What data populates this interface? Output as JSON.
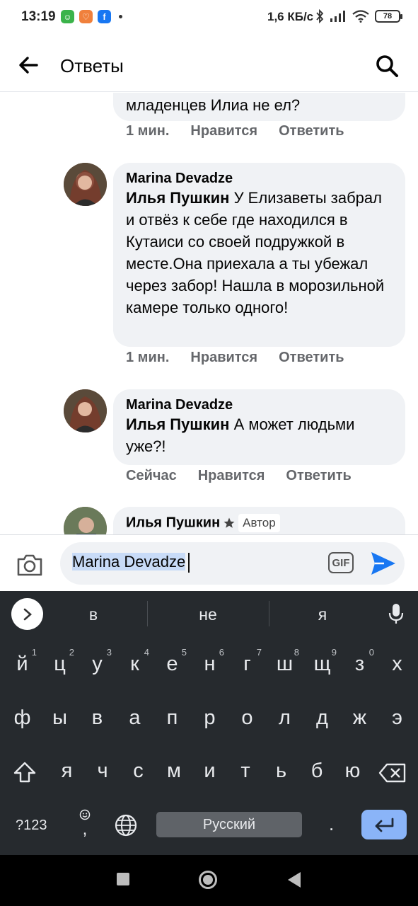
{
  "status_bar": {
    "time": "13:19",
    "net_speed": "1,6 КБ/с",
    "battery": "78",
    "app_icons": [
      {
        "name": "wechat-icon",
        "color": "#3bb34a",
        "glyph": "☺"
      },
      {
        "name": "notification-app-icon",
        "color": "#f0803c",
        "glyph": "♡"
      },
      {
        "name": "facebook-icon",
        "color": "#1877f2",
        "glyph": "f"
      }
    ]
  },
  "header": {
    "title": "Ответы"
  },
  "comments": [
    {
      "partial": true,
      "text": "младенцев Илиа не ел?",
      "time": "1 мин.",
      "like": "Нравится",
      "reply": "Ответить"
    },
    {
      "author": "Marina Devadze",
      "mention": "Илья Пушкин",
      "text": " У Елизаветы забрал и отвёз к себе где находился в Кутаиси со своей подружкой в месте.Она приехала а ты убежал через забор! Нашла в морозильной камере только одного!",
      "time": "1 мин.",
      "like": "Нравится",
      "reply": "Ответить"
    },
    {
      "author": "Marina Devadze",
      "mention": "Илья Пушкин",
      "text": " А может людьми уже?!",
      "time": "Сейчас",
      "like": "Нравится",
      "reply": "Ответить"
    },
    {
      "author": "Илья Пушкин",
      "badge": "Автор"
    }
  ],
  "composer": {
    "value": "Marina Devadze",
    "gif_label": "GIF"
  },
  "keyboard": {
    "suggestions": [
      "в",
      "не",
      "я"
    ],
    "row1": [
      "й",
      "ц",
      "у",
      "к",
      "е",
      "н",
      "г",
      "ш",
      "щ",
      "з",
      "х"
    ],
    "row1_hints": [
      "1",
      "2",
      "3",
      "4",
      "5",
      "6",
      "7",
      "8",
      "9",
      "0"
    ],
    "row2": [
      "ф",
      "ы",
      "в",
      "а",
      "п",
      "р",
      "о",
      "л",
      "д",
      "ж",
      "э"
    ],
    "row3": [
      "я",
      "ч",
      "с",
      "м",
      "и",
      "т",
      "ь",
      "б",
      "ю"
    ],
    "symbols_label": "?123",
    "comma": ",",
    "space_label": "Русский",
    "period": ".",
    "accent_color": "#8ab4f8"
  }
}
